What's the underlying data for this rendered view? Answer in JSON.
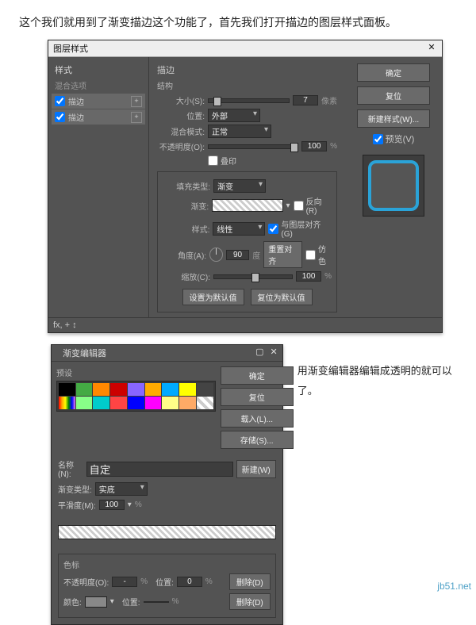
{
  "intro": "这个我们就用到了渐变描边这个功能了，首先我们打开描边的图层样式面板。",
  "layerStyle": {
    "title": "图层样式",
    "styles": {
      "header": "样式",
      "blendOptions": "混合选项",
      "items": [
        {
          "label": "描边",
          "checked": true
        },
        {
          "label": "描边",
          "checked": true
        }
      ]
    },
    "stroke": {
      "title": "描边",
      "structure": "结构",
      "size": {
        "label": "大小(S):",
        "value": "7",
        "unit": "像素"
      },
      "position": {
        "label": "位置:",
        "value": "外部"
      },
      "blendMode": {
        "label": "混合模式:",
        "value": "正常"
      },
      "opacity": {
        "label": "不透明度(O):",
        "value": "100",
        "unit": "%"
      },
      "overprint": "叠印",
      "fillType": {
        "label": "填充类型:",
        "value": "渐变"
      },
      "gradient": {
        "label": "渐变:",
        "reverse": "反向(R)"
      },
      "style": {
        "label": "样式:",
        "value": "线性",
        "align": "与图层对齐(G)"
      },
      "angle": {
        "label": "角度(A):",
        "value": "90",
        "unit": "度",
        "reset": "重置对齐",
        "dither": "仿色"
      },
      "scale": {
        "label": "缩放(C):",
        "value": "100",
        "unit": "%"
      },
      "setDefault": "设置为默认值",
      "resetDefault": "复位为默认值"
    },
    "buttons": {
      "ok": "确定",
      "cancel": "复位",
      "newStyle": "新建样式(W)...",
      "preview": "预览(V)"
    },
    "footer": "fx, + ↕"
  },
  "gradientEditor": {
    "title": "渐变编辑器",
    "presets": "预设",
    "buttons": {
      "ok": "确定",
      "cancel": "复位",
      "load": "载入(L)...",
      "save": "存储(S)...",
      "new": "新建(W)"
    },
    "name": {
      "label": "名称(N):",
      "value": "自定"
    },
    "type": {
      "label": "渐变类型:",
      "value": "实底"
    },
    "smooth": {
      "label": "平滑度(M):",
      "value": "100",
      "unit": "%"
    },
    "stops": {
      "title": "色标",
      "opacity": {
        "label": "不透明度(O):",
        "unit": "%"
      },
      "location": {
        "label": "位置:",
        "unit": "%"
      },
      "delete": "删除(D)",
      "color": {
        "label": "颜色:",
        "loc": "位置:",
        "del": "删除(D)"
      }
    },
    "swatches": [
      "#000",
      "#4a4",
      "#f80",
      "#c00",
      "#86f",
      "#fa0",
      "#0af",
      "#ff0",
      "#444",
      "linear-gradient(90deg,red,orange,yellow,green,blue,violet)",
      "#8f8",
      "#0cc",
      "#f44",
      "#00f",
      "#f0f",
      "#ff8",
      "#fa6",
      "repeating-linear-gradient(45deg,#ccc 0 4px,#fff 4px 8px)"
    ]
  },
  "caption": "用渐变编辑器编辑成透明的就可以了。",
  "watermark": "jb51.net"
}
